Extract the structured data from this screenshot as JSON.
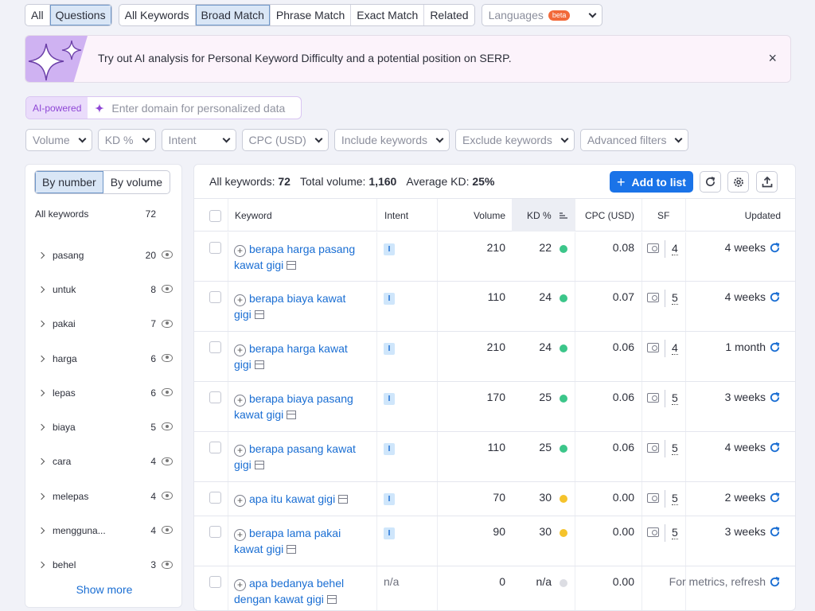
{
  "tabs": {
    "group1": [
      "All",
      "Questions"
    ],
    "group1_active": 1,
    "group2": [
      "All Keywords",
      "Broad Match",
      "Phrase Match",
      "Exact Match",
      "Related"
    ],
    "group2_active": 1,
    "languages": "Languages",
    "beta": "beta"
  },
  "banner": {
    "text_pre": "Try out ",
    "text_bold": "AI analysis",
    "text_post": " for Personal Keyword Difficulty and a potential position on SERP.",
    "close": "×"
  },
  "ai": {
    "badge": "AI-powered",
    "placeholder": "Enter domain for personalized data"
  },
  "filters": [
    "Volume",
    "KD %",
    "Intent",
    "CPC (USD)",
    "Include keywords",
    "Exclude keywords",
    "Advanced filters"
  ],
  "left": {
    "by_number": "By number",
    "by_volume": "By volume",
    "all_keywords_label": "All keywords",
    "all_keywords_count": "72",
    "groups": [
      {
        "name": "pasang",
        "count": "20"
      },
      {
        "name": "untuk",
        "count": "8"
      },
      {
        "name": "pakai",
        "count": "7"
      },
      {
        "name": "harga",
        "count": "6"
      },
      {
        "name": "lepas",
        "count": "6"
      },
      {
        "name": "biaya",
        "count": "5"
      },
      {
        "name": "cara",
        "count": "4"
      },
      {
        "name": "melepas",
        "count": "4"
      },
      {
        "name": "mengguna...",
        "count": "4"
      },
      {
        "name": "behel",
        "count": "3"
      }
    ],
    "show_more": "Show more"
  },
  "summary": {
    "all_keywords_label": "All keywords:",
    "all_keywords_value": "72",
    "total_volume_label": "Total volume:",
    "total_volume_value": "1,160",
    "avg_kd_label": "Average KD:",
    "avg_kd_value": "25%"
  },
  "toolbar": {
    "add_to_list": "Add to list",
    "add_icon": "plus-icon",
    "refresh_icon": "refresh-icon",
    "settings_icon": "gear-icon",
    "export_icon": "export-icon"
  },
  "table": {
    "headers": {
      "keyword": "Keyword",
      "intent": "Intent",
      "volume": "Volume",
      "kd": "KD %",
      "cpc": "CPC (USD)",
      "sf": "SF",
      "updated": "Updated"
    },
    "rows": [
      {
        "kw1": "berapa harga pasang",
        "kw2": "kawat gigi",
        "intent": "I",
        "volume": "210",
        "kd": "22",
        "kd_color": "#3cc68a",
        "cpc": "0.08",
        "sf": "4",
        "updated": "4 weeks"
      },
      {
        "kw1": "berapa biaya kawat",
        "kw2": "gigi",
        "intent": "I",
        "volume": "110",
        "kd": "24",
        "kd_color": "#3cc68a",
        "cpc": "0.07",
        "sf": "5",
        "updated": "4 weeks"
      },
      {
        "kw1": "berapa harga kawat",
        "kw2": "gigi",
        "intent": "I",
        "volume": "210",
        "kd": "24",
        "kd_color": "#3cc68a",
        "cpc": "0.06",
        "sf": "4",
        "updated": "1 month"
      },
      {
        "kw1": "berapa biaya pasang",
        "kw2": "kawat gigi",
        "intent": "I",
        "volume": "170",
        "kd": "25",
        "kd_color": "#3cc68a",
        "cpc": "0.06",
        "sf": "5",
        "updated": "3 weeks"
      },
      {
        "kw1": "berapa pasang kawat",
        "kw2": "gigi",
        "intent": "I",
        "volume": "110",
        "kd": "25",
        "kd_color": "#3cc68a",
        "cpc": "0.06",
        "sf": "5",
        "updated": "4 weeks"
      },
      {
        "kw1": "apa itu kawat gigi",
        "kw2": "",
        "intent": "I",
        "volume": "70",
        "kd": "30",
        "kd_color": "#f5c32c",
        "cpc": "0.00",
        "sf": "5",
        "updated": "2 weeks"
      },
      {
        "kw1": "berapa lama pakai",
        "kw2": "kawat gigi",
        "intent": "I",
        "volume": "90",
        "kd": "30",
        "kd_color": "#f5c32c",
        "cpc": "0.00",
        "sf": "5",
        "updated": "3 weeks"
      },
      {
        "kw1": "apa bedanya behel",
        "kw2": "dengan kawat gigi",
        "intent": "n/a",
        "volume": "0",
        "kd": "n/a",
        "kd_color": "#dcdde3",
        "cpc": "0.00",
        "sf": "",
        "updated": "For metrics, refresh"
      }
    ]
  }
}
